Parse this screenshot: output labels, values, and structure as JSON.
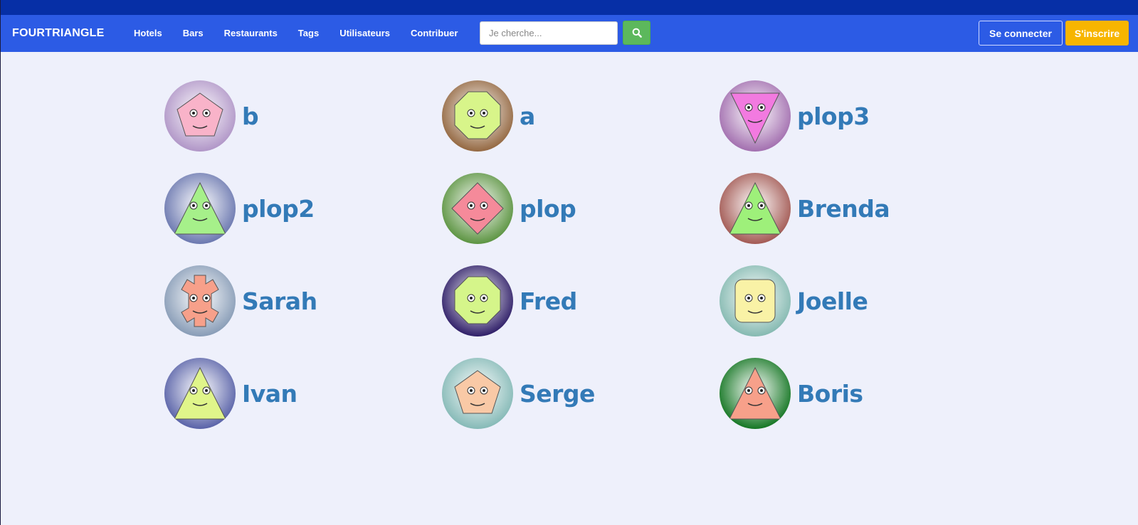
{
  "brand": "FOURTRIANGLE",
  "nav": [
    "Hotels",
    "Bars",
    "Restaurants",
    "Tags",
    "Utilisateurs",
    "Contribuer"
  ],
  "search": {
    "placeholder": "Je cherche..."
  },
  "auth": {
    "login": "Se connecter",
    "signup": "S'inscrire"
  },
  "colors": {
    "topstrip": "#062fa6",
    "navbar": "#2c5be5",
    "page_bg": "#eef0fb",
    "name_color": "#337ab7",
    "search_button": "#5cb85c",
    "signup_button": "#f7b500"
  },
  "users": [
    {
      "name": "b",
      "avatar": {
        "shape": "pentagon",
        "face": "#f9b3c9",
        "bg": "#a98cc2"
      }
    },
    {
      "name": "a",
      "avatar": {
        "shape": "octagon",
        "face": "#d8f58a",
        "bg": "#8a5a30"
      }
    },
    {
      "name": "plop3",
      "avatar": {
        "shape": "triangle-down",
        "face": "#f27ae0",
        "bg": "#9a62a8"
      }
    },
    {
      "name": "plop2",
      "avatar": {
        "shape": "triangle-up",
        "face": "#a6f08a",
        "bg": "#5d6ba8"
      }
    },
    {
      "name": "plop",
      "avatar": {
        "shape": "diamond",
        "face": "#f58a9a",
        "bg": "#4d8a30"
      }
    },
    {
      "name": "Brenda",
      "avatar": {
        "shape": "triangle-up",
        "face": "#9ef07a",
        "bg": "#9a4a44"
      }
    },
    {
      "name": "Sarah",
      "avatar": {
        "shape": "gear",
        "face": "#f7a08a",
        "bg": "#7d93b0"
      }
    },
    {
      "name": "Fred",
      "avatar": {
        "shape": "octagon",
        "face": "#d5f58a",
        "bg": "#1c0a5a"
      }
    },
    {
      "name": "Joelle",
      "avatar": {
        "shape": "rounded-square",
        "face": "#f9f2a6",
        "bg": "#7ab3aa"
      }
    },
    {
      "name": "Ivan",
      "avatar": {
        "shape": "triangle-up",
        "face": "#e0f58a",
        "bg": "#4a54a0"
      }
    },
    {
      "name": "Serge",
      "avatar": {
        "shape": "pentagon",
        "face": "#f9c9a6",
        "bg": "#7ab3b0"
      }
    },
    {
      "name": "Boris",
      "avatar": {
        "shape": "triangle-up",
        "face": "#f7a08a",
        "bg": "#006a10"
      }
    }
  ]
}
